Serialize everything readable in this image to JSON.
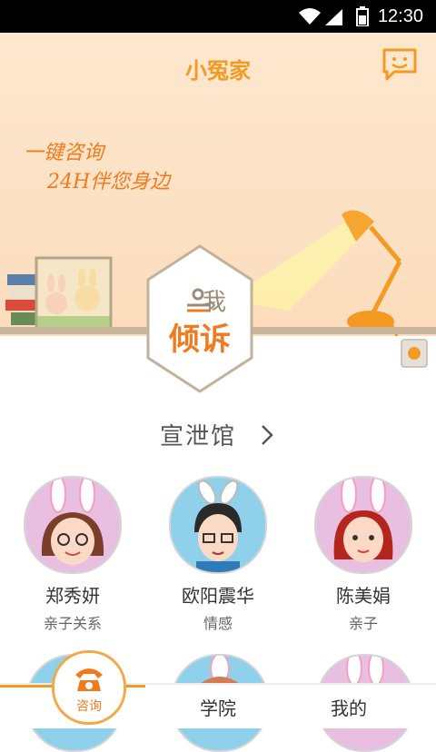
{
  "status_bar": {
    "time": "12:30"
  },
  "header": {
    "title": "小冤家"
  },
  "hero": {
    "slogan_line1": "一键咨询",
    "slogan_line2": "24H伴您身边",
    "hex_top_text": "我",
    "hex_main_text": "倾诉"
  },
  "section": {
    "title": "宣泄馆"
  },
  "counselors": [
    {
      "name": "郑秀妍",
      "tag": "亲子关系"
    },
    {
      "name": "欧阳震华",
      "tag": "情感"
    },
    {
      "name": "陈美娟",
      "tag": "亲子"
    }
  ],
  "bottom_nav": {
    "consult_label": "咨询",
    "college_label": "学院",
    "mine_label": "我的"
  },
  "colors": {
    "accent": "#f39a23",
    "brand_orange": "#f07a1d"
  }
}
